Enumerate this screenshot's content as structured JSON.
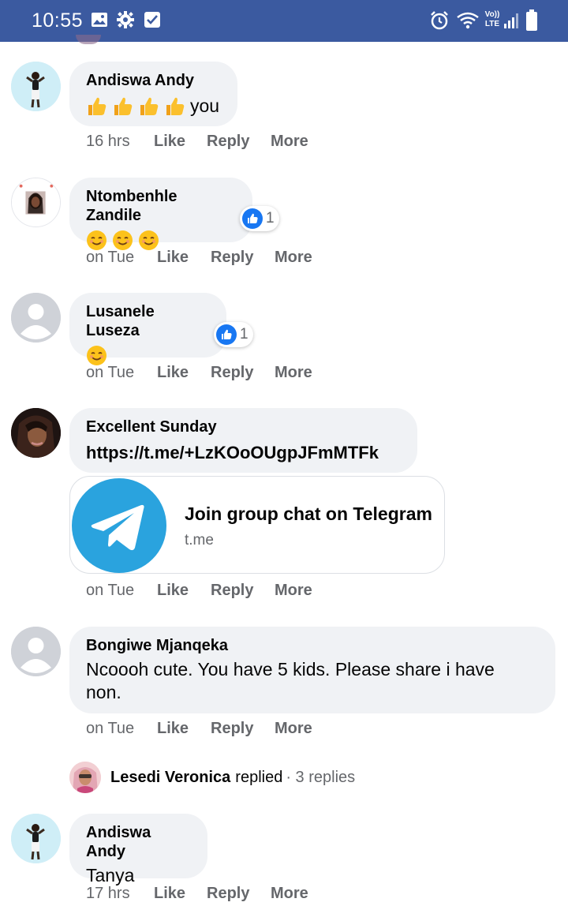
{
  "status_bar": {
    "time": "10:55",
    "left_icons": [
      "gallery-icon",
      "settings-gear-icon",
      "checkbox-icon"
    ],
    "right_icons": [
      "alarm-icon",
      "wifi-icon",
      "volte-icon",
      "signal-icon",
      "battery-icon"
    ],
    "volte_text_top": "Vo))",
    "volte_text_bottom": "LTE",
    "bg_color": "#3b5aa0"
  },
  "comments": [
    {
      "author": "Andiswa Andy",
      "emojis": [
        "thumbs-up",
        "thumbs-up",
        "thumbs-up",
        "thumbs-up"
      ],
      "text": "you",
      "time": "16 hrs",
      "actions": [
        "Like",
        "Reply",
        "More"
      ]
    },
    {
      "author": "Ntombenhle Zandile",
      "emojis": [
        "smiling-face",
        "smiling-face",
        "smiling-face"
      ],
      "text": "",
      "reaction_count": "1",
      "time": "on Tue",
      "actions": [
        "Like",
        "Reply",
        "More"
      ]
    },
    {
      "author": "Lusanele Luseza",
      "emojis": [
        "smiling-face"
      ],
      "text": "",
      "reaction_count": "1",
      "time": "on Tue",
      "actions": [
        "Like",
        "Reply",
        "More"
      ]
    },
    {
      "author": "Excellent Sunday",
      "text": "https://t.me/+LzKOoOUgpJFmMTFk",
      "link_preview": {
        "title": "Join group chat on Telegram",
        "domain": "t.me",
        "icon": "telegram-icon"
      },
      "time": "on Tue",
      "actions": [
        "Like",
        "Reply",
        "More"
      ]
    },
    {
      "author": "Bongiwe Mjanqeka",
      "text_line1": "Ncoooh cute. You have 5 kids. Please share i have",
      "text_line2": "non.",
      "time": "on Tue",
      "actions": [
        "Like",
        "Reply",
        "More"
      ],
      "replies": {
        "name": "Lesedi Veronica",
        "word": "replied",
        "count": "· 3 replies"
      }
    },
    {
      "author": "Andiswa Andy",
      "text": "Tanya",
      "time": "17 hrs",
      "actions": [
        "Like",
        "Reply",
        "More"
      ]
    }
  ],
  "colors": {
    "bubble": "#f0f2f5",
    "meta": "#65676b",
    "like_blue": "#1877f2",
    "telegram": "#2aa3de"
  }
}
